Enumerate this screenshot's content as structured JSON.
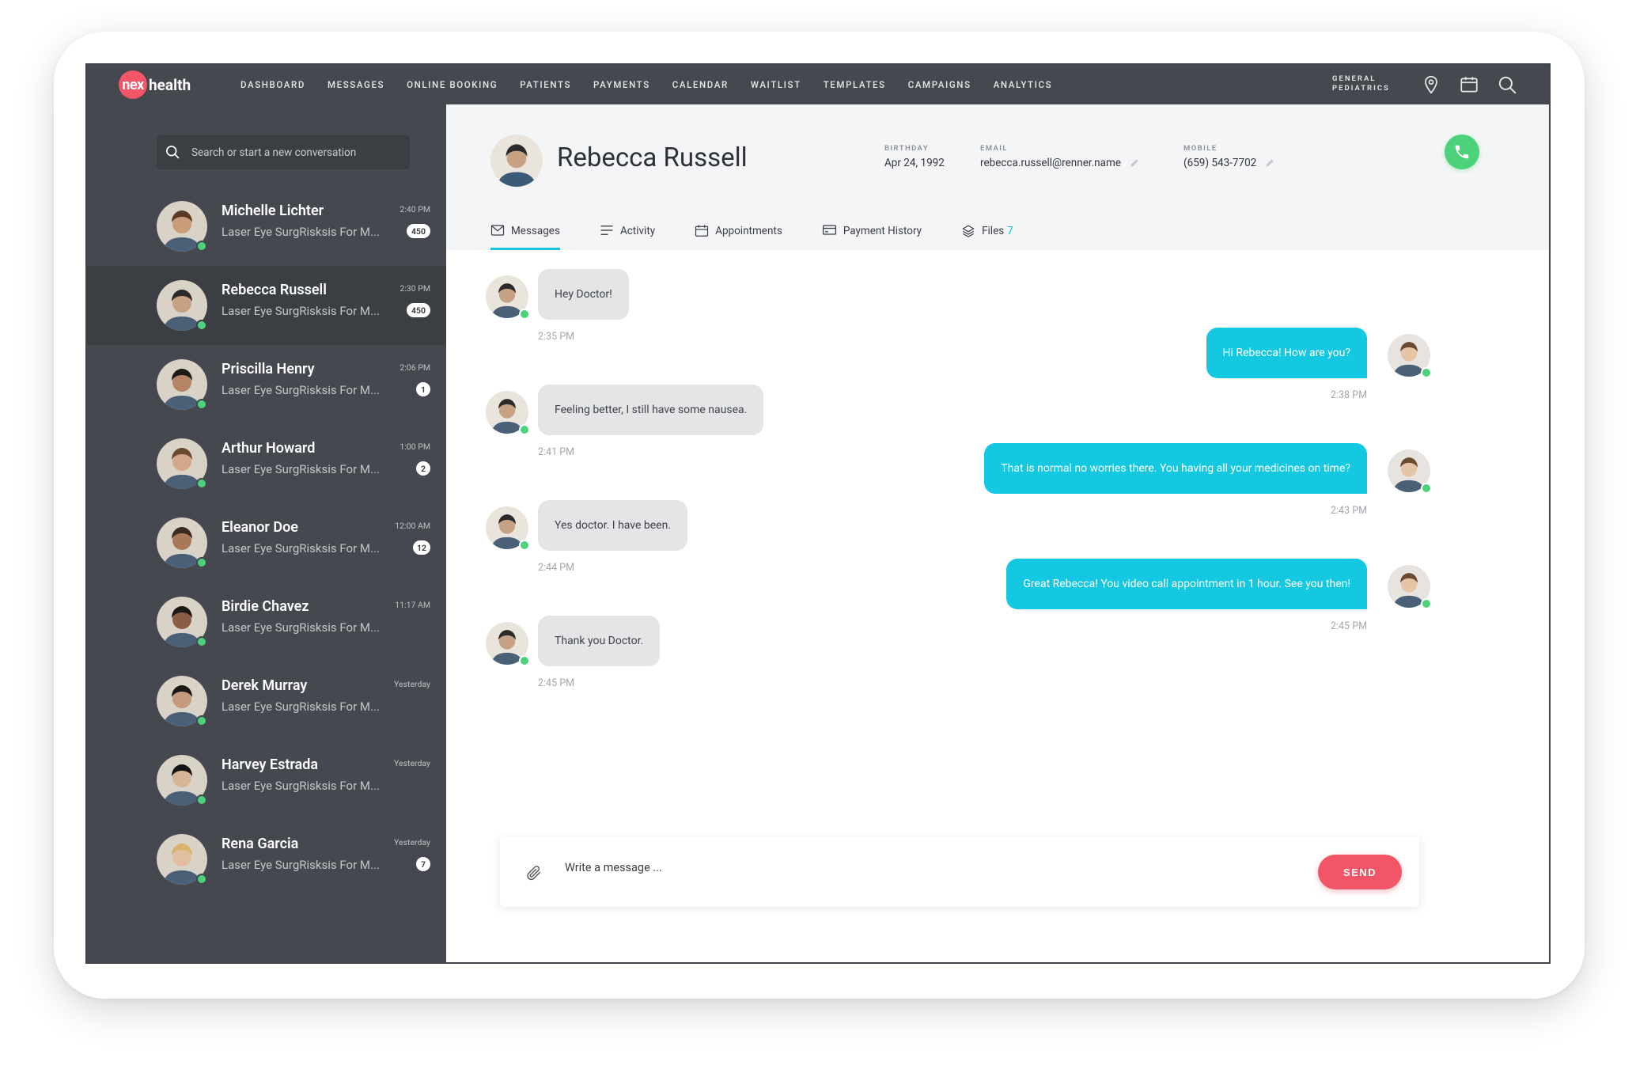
{
  "brand": {
    "logo_mark": "nex",
    "logo_text": "health"
  },
  "nav": {
    "items": [
      "DASHBOARD",
      "MESSAGES",
      "ONLINE BOOKING",
      "PATIENTS",
      "PAYMENTS",
      "CALENDAR",
      "WAITLIST",
      "TEMPLATES",
      "CAMPAIGNS",
      "ANALYTICS"
    ],
    "practice_line1": "GENERAL",
    "practice_line2": "PEDIATRICS",
    "icons": [
      "location-pin-icon",
      "calendar-icon",
      "search-icon"
    ]
  },
  "sidebar": {
    "search_placeholder": "Search or start a new conversation",
    "conversations": [
      {
        "name": "Michelle Lichter",
        "preview": "Laser Eye SurgRisksis For M...",
        "time": "2:40 PM",
        "badge": "450",
        "skin": "#c99c7a",
        "hair": "#5a3a25",
        "active": false
      },
      {
        "name": "Rebecca Russell",
        "preview": "Laser Eye SurgRisksis For M...",
        "time": "2:30 PM",
        "badge": "450",
        "skin": "#c7a184",
        "hair": "#2b2b2b",
        "active": true
      },
      {
        "name": "Priscilla Henry",
        "preview": "Laser Eye SurgRisksis For M...",
        "time": "2:06 PM",
        "badge": "1",
        "skin": "#b58366",
        "hair": "#1e1a18",
        "active": false
      },
      {
        "name": "Arthur Howard",
        "preview": "Laser Eye SurgRisksis For M...",
        "time": "1:00 PM",
        "badge": "2",
        "skin": "#d1a98a",
        "hair": "#6b4a30",
        "active": false
      },
      {
        "name": "Eleanor Doe",
        "preview": "Laser Eye SurgRisksis For M...",
        "time": "12:00 AM",
        "badge": "12",
        "skin": "#a9785a",
        "hair": "#3a2a20",
        "active": false
      },
      {
        "name": "Birdie Chavez",
        "preview": "Laser Eye SurgRisksis For M...",
        "time": "11:17 AM",
        "badge": "",
        "skin": "#8a5e44",
        "hair": "#1c1816",
        "active": false
      },
      {
        "name": "Derek Murray",
        "preview": "Laser Eye SurgRisksis For M...",
        "time": "Yesterday",
        "badge": "",
        "skin": "#c49a7c",
        "hair": "#1a1715",
        "active": false
      },
      {
        "name": "Harvey Estrada",
        "preview": "Laser Eye SurgRisksis For M...",
        "time": "Yesterday",
        "badge": "",
        "skin": "#d6b597",
        "hair": "#141414",
        "active": false
      },
      {
        "name": "Rena Garcia",
        "preview": "Laser Eye SurgRisksis For M...",
        "time": "Yesterday",
        "badge": "7",
        "skin": "#e2bfa0",
        "hair": "#d9b46a",
        "active": false
      }
    ]
  },
  "profile": {
    "name": "Rebecca Russell",
    "birthday_label": "BIRTHDAY",
    "birthday": "Apr 24, 1992",
    "email_label": "EMAIL",
    "email": "rebecca.russell@renner.name",
    "mobile_label": "MOBILE",
    "mobile": "(659) 543-7702"
  },
  "tabs": [
    {
      "label": "Messages",
      "icon": "envelope-icon",
      "active": true
    },
    {
      "label": "Activity",
      "icon": "list-icon",
      "active": false
    },
    {
      "label": "Appointments",
      "icon": "calendar-icon",
      "active": false
    },
    {
      "label": "Payment History",
      "icon": "card-icon",
      "active": false
    },
    {
      "label": "Files",
      "icon": "layers-icon",
      "count": "7",
      "active": false
    }
  ],
  "messages": [
    {
      "direction": "in",
      "text": "Hey Doctor!",
      "time": "2:35 PM"
    },
    {
      "direction": "out",
      "text": "Hi Rebecca! How are you?",
      "time": "2:38 PM"
    },
    {
      "direction": "in",
      "text": "Feeling better, I still have some nausea.",
      "time": "2:41 PM"
    },
    {
      "direction": "out",
      "text": "That is normal no worries there. You having all your medicines on time?",
      "time": "2:43 PM"
    },
    {
      "direction": "in",
      "text": "Yes doctor. I have been.",
      "time": "2:44 PM"
    },
    {
      "direction": "out",
      "text": "Great Rebecca!  You video call appointment in 1 hour. See you then!",
      "time": "2:45 PM"
    },
    {
      "direction": "in",
      "text": "Thank you Doctor.",
      "time": "2:45 PM"
    }
  ],
  "composer": {
    "placeholder": "Write a message ...",
    "send_label": "SEND"
  },
  "colors": {
    "accent": "#14c8e2",
    "brand": "#f25567",
    "online": "#4cd27a",
    "sidebar": "#45494f"
  }
}
